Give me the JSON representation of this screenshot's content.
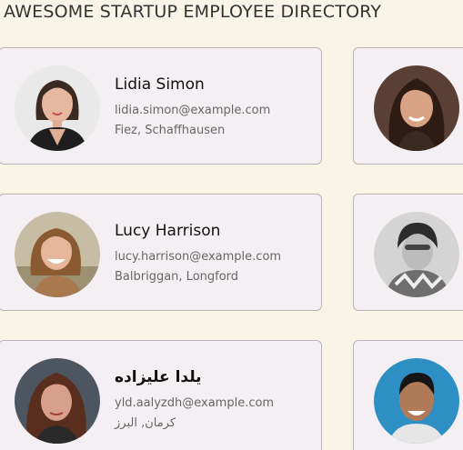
{
  "page": {
    "title": "AWESOME STARTUP EMPLOYEE DIRECTORY"
  },
  "employees": [
    {
      "name": "Lidia Simon",
      "email": "lidia.simon@example.com",
      "location": "Fiez, Schaffhausen"
    },
    {
      "name": "Lucy Harrison",
      "email": "lucy.harrison@example.com",
      "location": "Balbriggan, Longford"
    },
    {
      "name": "يلدا عليزاده",
      "email": "yld.aalyzdh@example.com",
      "location": "كرمان, البرز"
    }
  ],
  "colors": {
    "background": "#f8f4e6",
    "card": "#f4eff2",
    "card_border": "#b8b4b8",
    "name_text": "#111111",
    "meta_text": "#666666"
  }
}
